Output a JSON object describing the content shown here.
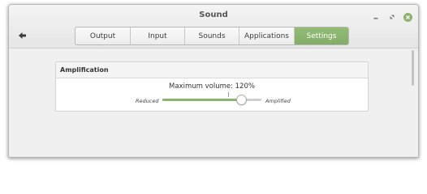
{
  "window": {
    "title": "Sound"
  },
  "tabs": [
    {
      "label": "Output",
      "active": false
    },
    {
      "label": "Input",
      "active": false
    },
    {
      "label": "Sounds",
      "active": false
    },
    {
      "label": "Applications",
      "active": false
    },
    {
      "label": "Settings",
      "active": true
    }
  ],
  "amplification": {
    "header": "Amplification",
    "volume_label": "Maximum volume: 120%",
    "slider": {
      "left_label": "Reduced",
      "right_label": "Amplified",
      "min": 0,
      "max": 150,
      "value": 120,
      "mark": 100
    }
  },
  "icons": {
    "back": "back-arrow-icon",
    "minimize": "minimize-icon",
    "maximize": "maximize-icon",
    "close": "close-icon"
  },
  "colors": {
    "accent": "#8bb56d",
    "tab_active": "#8bb56d",
    "close_button": "#8cb36c"
  }
}
